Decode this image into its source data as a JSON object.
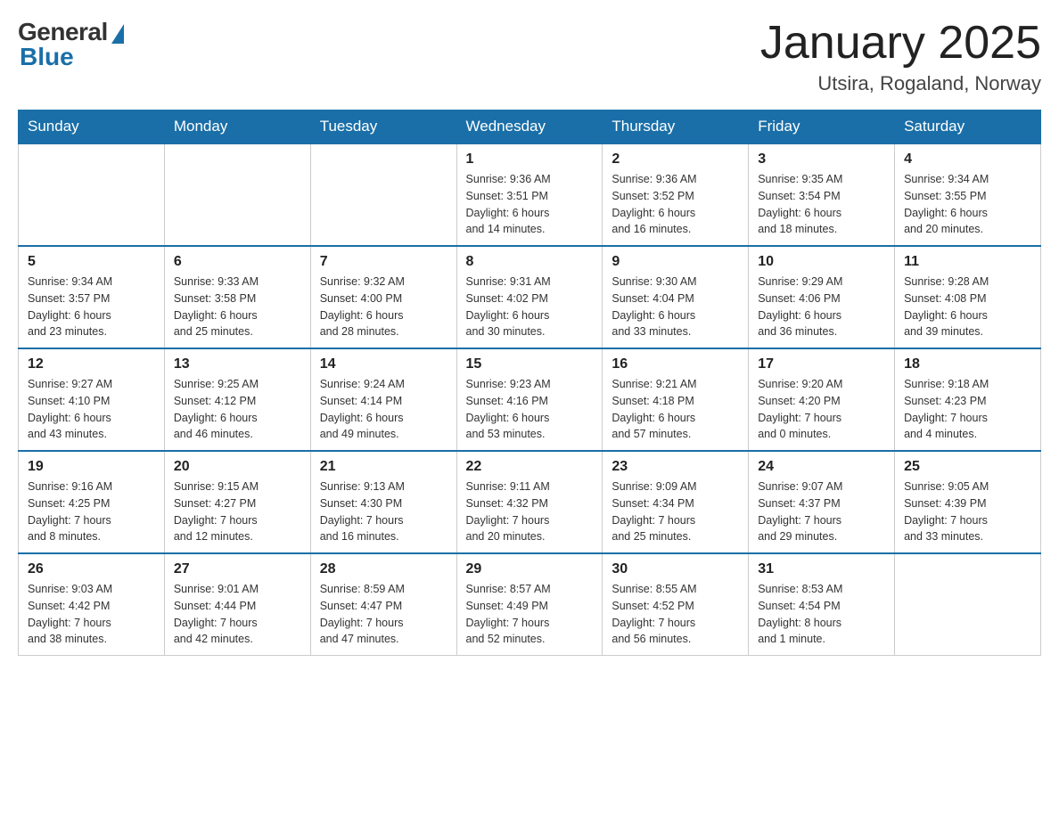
{
  "header": {
    "logo_general": "General",
    "logo_blue": "Blue",
    "month_title": "January 2025",
    "location": "Utsira, Rogaland, Norway"
  },
  "weekdays": [
    "Sunday",
    "Monday",
    "Tuesday",
    "Wednesday",
    "Thursday",
    "Friday",
    "Saturday"
  ],
  "weeks": [
    [
      {
        "day": "",
        "info": ""
      },
      {
        "day": "",
        "info": ""
      },
      {
        "day": "",
        "info": ""
      },
      {
        "day": "1",
        "info": "Sunrise: 9:36 AM\nSunset: 3:51 PM\nDaylight: 6 hours\nand 14 minutes."
      },
      {
        "day": "2",
        "info": "Sunrise: 9:36 AM\nSunset: 3:52 PM\nDaylight: 6 hours\nand 16 minutes."
      },
      {
        "day": "3",
        "info": "Sunrise: 9:35 AM\nSunset: 3:54 PM\nDaylight: 6 hours\nand 18 minutes."
      },
      {
        "day": "4",
        "info": "Sunrise: 9:34 AM\nSunset: 3:55 PM\nDaylight: 6 hours\nand 20 minutes."
      }
    ],
    [
      {
        "day": "5",
        "info": "Sunrise: 9:34 AM\nSunset: 3:57 PM\nDaylight: 6 hours\nand 23 minutes."
      },
      {
        "day": "6",
        "info": "Sunrise: 9:33 AM\nSunset: 3:58 PM\nDaylight: 6 hours\nand 25 minutes."
      },
      {
        "day": "7",
        "info": "Sunrise: 9:32 AM\nSunset: 4:00 PM\nDaylight: 6 hours\nand 28 minutes."
      },
      {
        "day": "8",
        "info": "Sunrise: 9:31 AM\nSunset: 4:02 PM\nDaylight: 6 hours\nand 30 minutes."
      },
      {
        "day": "9",
        "info": "Sunrise: 9:30 AM\nSunset: 4:04 PM\nDaylight: 6 hours\nand 33 minutes."
      },
      {
        "day": "10",
        "info": "Sunrise: 9:29 AM\nSunset: 4:06 PM\nDaylight: 6 hours\nand 36 minutes."
      },
      {
        "day": "11",
        "info": "Sunrise: 9:28 AM\nSunset: 4:08 PM\nDaylight: 6 hours\nand 39 minutes."
      }
    ],
    [
      {
        "day": "12",
        "info": "Sunrise: 9:27 AM\nSunset: 4:10 PM\nDaylight: 6 hours\nand 43 minutes."
      },
      {
        "day": "13",
        "info": "Sunrise: 9:25 AM\nSunset: 4:12 PM\nDaylight: 6 hours\nand 46 minutes."
      },
      {
        "day": "14",
        "info": "Sunrise: 9:24 AM\nSunset: 4:14 PM\nDaylight: 6 hours\nand 49 minutes."
      },
      {
        "day": "15",
        "info": "Sunrise: 9:23 AM\nSunset: 4:16 PM\nDaylight: 6 hours\nand 53 minutes."
      },
      {
        "day": "16",
        "info": "Sunrise: 9:21 AM\nSunset: 4:18 PM\nDaylight: 6 hours\nand 57 minutes."
      },
      {
        "day": "17",
        "info": "Sunrise: 9:20 AM\nSunset: 4:20 PM\nDaylight: 7 hours\nand 0 minutes."
      },
      {
        "day": "18",
        "info": "Sunrise: 9:18 AM\nSunset: 4:23 PM\nDaylight: 7 hours\nand 4 minutes."
      }
    ],
    [
      {
        "day": "19",
        "info": "Sunrise: 9:16 AM\nSunset: 4:25 PM\nDaylight: 7 hours\nand 8 minutes."
      },
      {
        "day": "20",
        "info": "Sunrise: 9:15 AM\nSunset: 4:27 PM\nDaylight: 7 hours\nand 12 minutes."
      },
      {
        "day": "21",
        "info": "Sunrise: 9:13 AM\nSunset: 4:30 PM\nDaylight: 7 hours\nand 16 minutes."
      },
      {
        "day": "22",
        "info": "Sunrise: 9:11 AM\nSunset: 4:32 PM\nDaylight: 7 hours\nand 20 minutes."
      },
      {
        "day": "23",
        "info": "Sunrise: 9:09 AM\nSunset: 4:34 PM\nDaylight: 7 hours\nand 25 minutes."
      },
      {
        "day": "24",
        "info": "Sunrise: 9:07 AM\nSunset: 4:37 PM\nDaylight: 7 hours\nand 29 minutes."
      },
      {
        "day": "25",
        "info": "Sunrise: 9:05 AM\nSunset: 4:39 PM\nDaylight: 7 hours\nand 33 minutes."
      }
    ],
    [
      {
        "day": "26",
        "info": "Sunrise: 9:03 AM\nSunset: 4:42 PM\nDaylight: 7 hours\nand 38 minutes."
      },
      {
        "day": "27",
        "info": "Sunrise: 9:01 AM\nSunset: 4:44 PM\nDaylight: 7 hours\nand 42 minutes."
      },
      {
        "day": "28",
        "info": "Sunrise: 8:59 AM\nSunset: 4:47 PM\nDaylight: 7 hours\nand 47 minutes."
      },
      {
        "day": "29",
        "info": "Sunrise: 8:57 AM\nSunset: 4:49 PM\nDaylight: 7 hours\nand 52 minutes."
      },
      {
        "day": "30",
        "info": "Sunrise: 8:55 AM\nSunset: 4:52 PM\nDaylight: 7 hours\nand 56 minutes."
      },
      {
        "day": "31",
        "info": "Sunrise: 8:53 AM\nSunset: 4:54 PM\nDaylight: 8 hours\nand 1 minute."
      },
      {
        "day": "",
        "info": ""
      }
    ]
  ]
}
